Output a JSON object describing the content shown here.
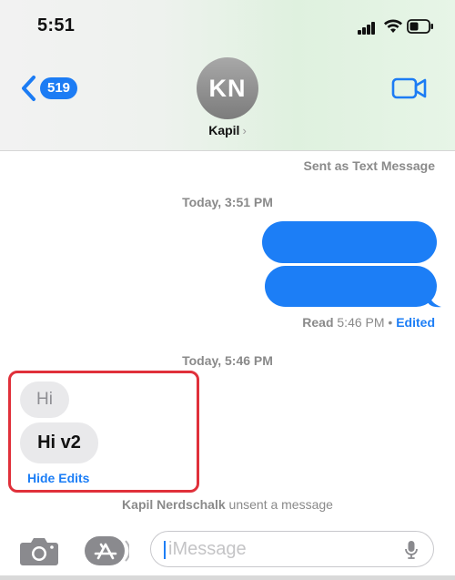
{
  "status_bar": {
    "time": "5:51"
  },
  "header": {
    "back_count": "519",
    "avatar_initials": "KN",
    "contact_name": "Kapil"
  },
  "conversation": {
    "sent_as_text": "Sent as Text Message",
    "timestamp_1": "Today, 3:51 PM",
    "read_label": "Read",
    "read_time": "5:46 PM",
    "separator": "•",
    "edited_label": "Edited",
    "timestamp_2": "Today, 5:46 PM",
    "received_original": "Hi",
    "received_edited": "Hi v2",
    "hide_edits_label": "Hide Edits",
    "unsent_name": "Kapil Nerdschalk",
    "unsent_text": "unsent a message"
  },
  "input_bar": {
    "placeholder": "iMessage"
  },
  "colors": {
    "accent": "#1c7ef6",
    "highlight": "#e0303a"
  },
  "icons": [
    "chevron-left-icon",
    "video-camera-icon",
    "camera-icon",
    "app-store-icon",
    "microphone-icon",
    "signal-icon",
    "wifi-icon",
    "battery-icon"
  ]
}
